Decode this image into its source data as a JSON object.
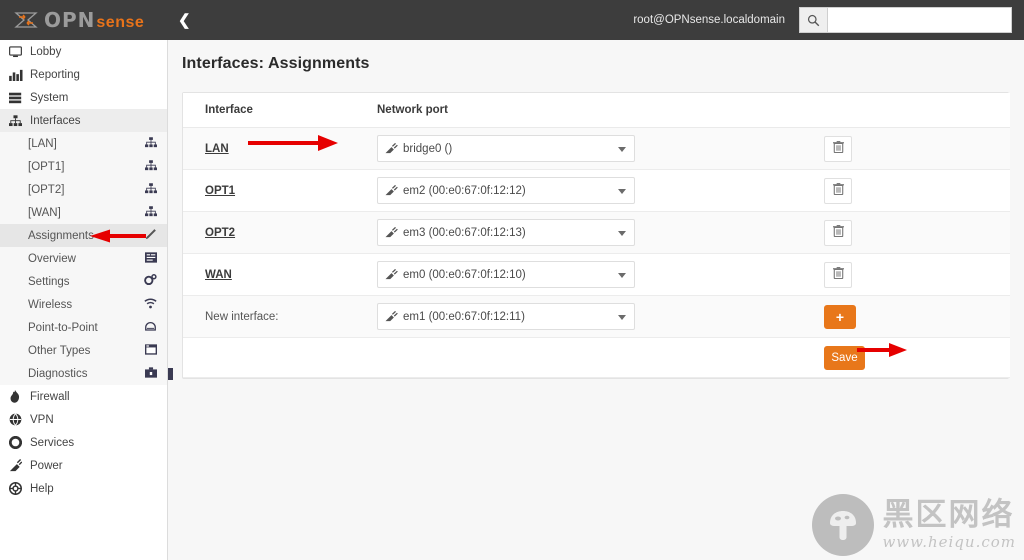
{
  "topbar": {
    "logo_primary": "OPN",
    "logo_secondary": "sense",
    "collapse_icon": "chevron-left-icon",
    "user": "root@OPNsense.localdomain",
    "search_placeholder": "",
    "search_value": "",
    "search_icon": "search-icon"
  },
  "sidebar": {
    "items": [
      {
        "label": "Lobby",
        "icon": "monitor-icon"
      },
      {
        "label": "Reporting",
        "icon": "bar-chart-icon"
      },
      {
        "label": "System",
        "icon": "server-stack-icon"
      },
      {
        "label": "Interfaces",
        "icon": "sitemap-icon",
        "active": true
      }
    ],
    "subitems": [
      {
        "label": "[LAN]",
        "icon": "sitemap-icon",
        "selected": false
      },
      {
        "label": "[OPT1]",
        "icon": "sitemap-icon",
        "selected": false
      },
      {
        "label": "[OPT2]",
        "icon": "sitemap-icon",
        "selected": false
      },
      {
        "label": "[WAN]",
        "icon": "sitemap-icon",
        "selected": false
      },
      {
        "label": "Assignments",
        "icon": "pencil-icon",
        "selected": true
      },
      {
        "label": "Overview",
        "icon": "list-icon",
        "selected": false
      },
      {
        "label": "Settings",
        "icon": "gears-icon",
        "selected": false
      },
      {
        "label": "Wireless",
        "icon": "wifi-icon",
        "selected": false
      },
      {
        "label": "Point-to-Point",
        "icon": "modem-icon",
        "selected": false
      },
      {
        "label": "Other Types",
        "icon": "window-icon",
        "selected": false
      },
      {
        "label": "Diagnostics",
        "icon": "toolbox-icon",
        "selected": false
      }
    ],
    "items_bottom": [
      {
        "label": "Firewall",
        "icon": "fire-icon"
      },
      {
        "label": "VPN",
        "icon": "globe-lock-icon"
      },
      {
        "label": "Services",
        "icon": "gear-icon"
      },
      {
        "label": "Power",
        "icon": "power-plug-icon"
      },
      {
        "label": "Help",
        "icon": "lifebuoy-icon"
      }
    ]
  },
  "page": {
    "title": "Interfaces: Assignments"
  },
  "table": {
    "headers": {
      "interface": "Interface",
      "network_port": "Network port"
    },
    "rows": [
      {
        "interface": "LAN",
        "is_link": true,
        "port": "bridge0 ()",
        "action": "delete",
        "delete_icon": "trash-icon"
      },
      {
        "interface": "OPT1",
        "is_link": true,
        "port": "em2 (00:e0:67:0f:12:12)",
        "action": "delete",
        "delete_icon": "trash-icon"
      },
      {
        "interface": "OPT2",
        "is_link": true,
        "port": "em3 (00:e0:67:0f:12:13)",
        "action": "delete",
        "delete_icon": "trash-icon"
      },
      {
        "interface": "WAN",
        "is_link": true,
        "port": "em0 (00:e0:67:0f:12:10)",
        "action": "delete",
        "delete_icon": "trash-icon"
      }
    ],
    "new_row": {
      "label": "New interface:",
      "port": "em1 (00:e0:67:0f:12:11)",
      "add_label": "+",
      "add_icon": "plus-icon"
    },
    "save_label": "Save",
    "port_icon": "ethernet-plug-icon"
  },
  "annotations": {
    "arrow_color": "#e60000",
    "arrows": [
      {
        "name": "arrow-to-lan-port",
        "direction": "right"
      },
      {
        "name": "arrow-to-assignments",
        "direction": "left"
      },
      {
        "name": "arrow-to-save-button",
        "direction": "right"
      }
    ]
  },
  "watermark": {
    "chinese": "黑区网络",
    "url": "www.heiqu.com",
    "logo_icon": "mushroom-icon"
  },
  "colors": {
    "accent_orange": "#e8771a",
    "topbar_bg": "#3d3d3d",
    "content_bg": "#f7f7f7",
    "arrow_red": "#e60000"
  }
}
